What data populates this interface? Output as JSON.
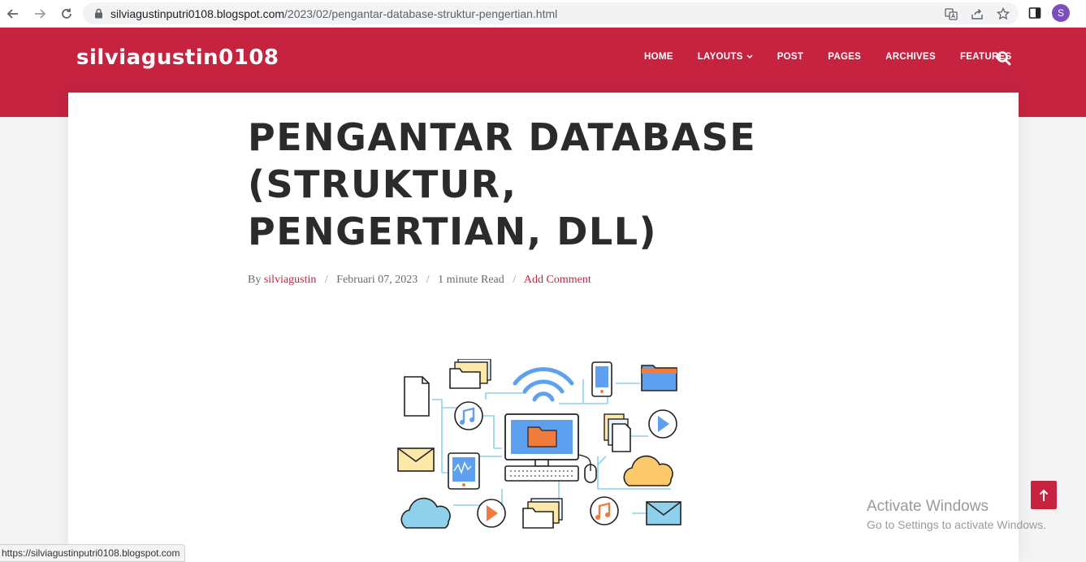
{
  "browser": {
    "url_host": "silviagustinputri0108.blogspot.com",
    "url_path": "/2023/02/pengantar-database-struktur-pengertian.html",
    "profile_initial": "S"
  },
  "site": {
    "title": "silviagustin0108",
    "nav": [
      {
        "label": "HOME"
      },
      {
        "label": "LAYOUTS"
      },
      {
        "label": "POST"
      },
      {
        "label": "PAGES"
      },
      {
        "label": "ARCHIVES"
      },
      {
        "label": "FEATURES"
      }
    ]
  },
  "post": {
    "title": "PENGANTAR DATABASE (STRUKTUR, PENGERTIAN, DLL)",
    "meta": {
      "by": "By",
      "author": "silviagustin",
      "date": "Februari 07, 2023",
      "read_time": "1 minute Read",
      "comment": "Add Comment",
      "separator": "/"
    }
  },
  "windows_watermark": {
    "line1": "Activate Windows",
    "line2": "Go to Settings to activate Windows."
  },
  "status_bar": {
    "text": "https://silviagustinputri0108.blogspot.com"
  },
  "colors": {
    "brand": "#c62340",
    "title_text": "#2b2b2b"
  }
}
